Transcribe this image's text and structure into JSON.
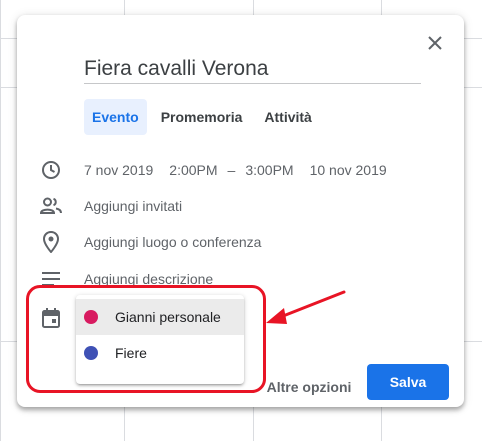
{
  "event": {
    "title": "Fiera cavalli Verona"
  },
  "tabs": [
    {
      "label": "Evento",
      "active": true
    },
    {
      "label": "Promemoria",
      "active": false
    },
    {
      "label": "Attività",
      "active": false
    }
  ],
  "datetime": {
    "start_date": "7 nov 2019",
    "start_time": "2:00PM",
    "separator": "–",
    "end_time": "3:00PM",
    "end_date": "10 nov 2019"
  },
  "fields": {
    "guests": "Aggiungi invitati",
    "location": "Aggiungi luogo o conferenza",
    "description": "Aggiungi descrizione"
  },
  "calendar_menu": {
    "items": [
      {
        "label": "Gianni personale",
        "color": "#d81b60"
      },
      {
        "label": "Fiere",
        "color": "#3f51b5"
      }
    ]
  },
  "footer": {
    "more_options": "Altre opzioni",
    "save": "Salva"
  },
  "colors": {
    "accent": "#1a73e8",
    "annotation": "#e81425"
  }
}
